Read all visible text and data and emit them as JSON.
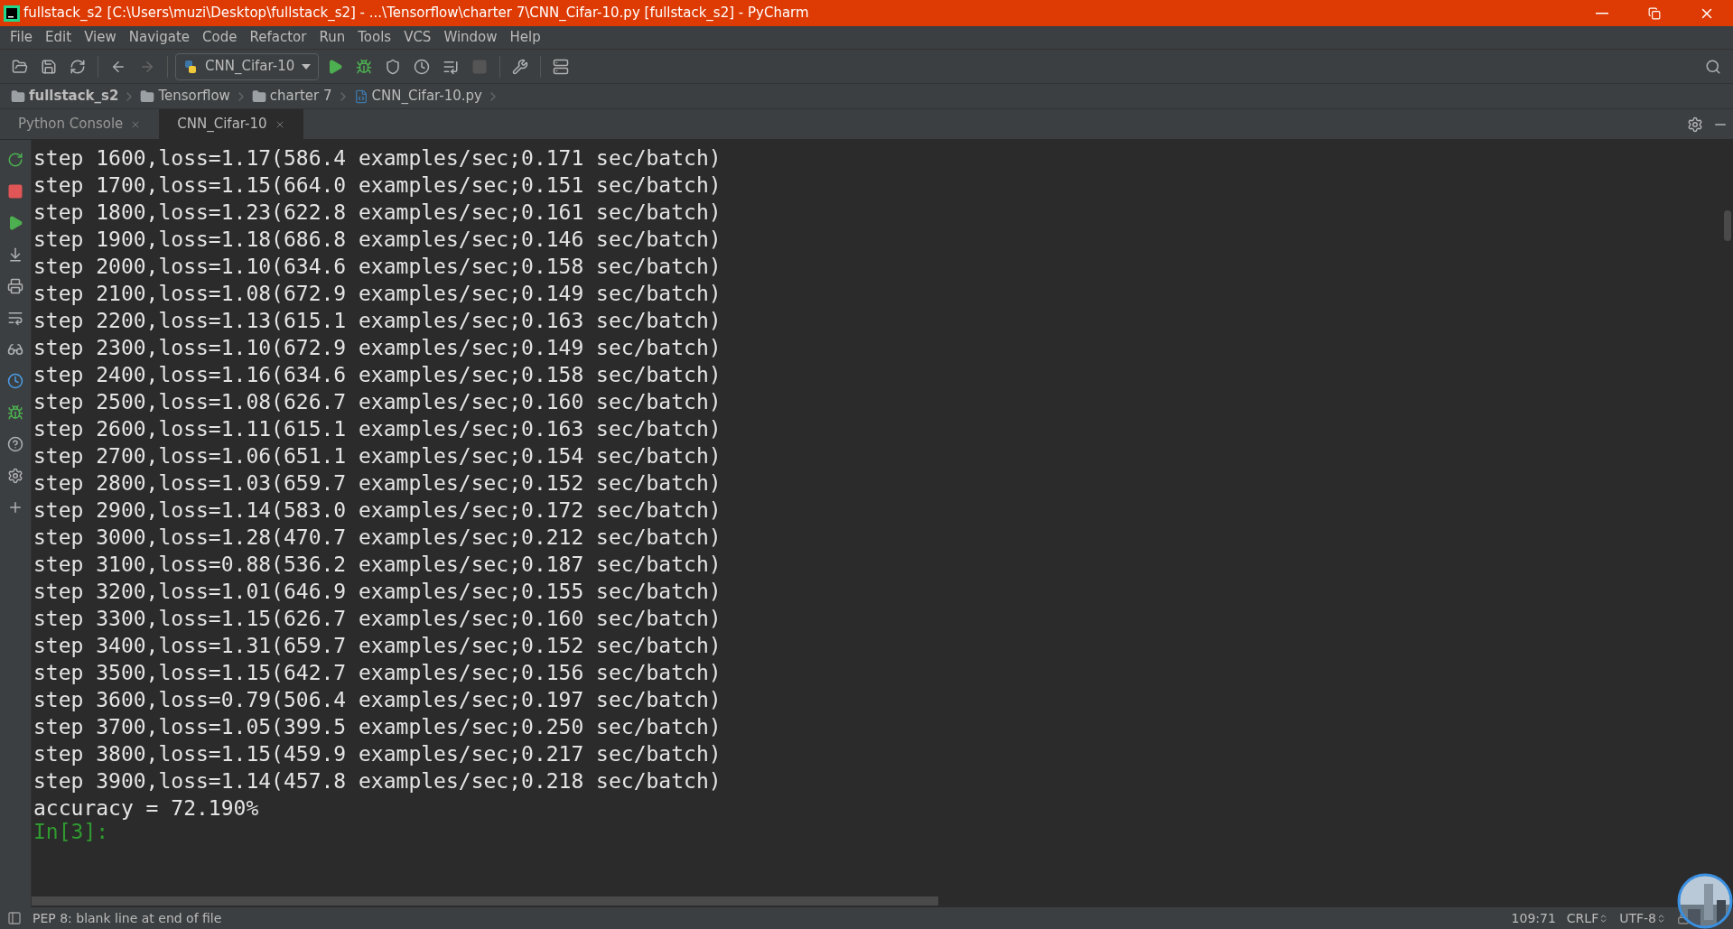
{
  "window": {
    "title": "fullstack_s2 [C:\\Users\\muzi\\Desktop\\fullstack_s2] - ...\\Tensorflow\\charter 7\\CNN_Cifar-10.py [fullstack_s2] - PyCharm"
  },
  "menu": [
    "File",
    "Edit",
    "View",
    "Navigate",
    "Code",
    "Refactor",
    "Run",
    "Tools",
    "VCS",
    "Window",
    "Help"
  ],
  "toolbar": {
    "run_config": "CNN_Cifar-10"
  },
  "breadcrumbs": [
    {
      "label": "fullstack_s2",
      "kind": "folder",
      "bold": true
    },
    {
      "label": "Tensorflow",
      "kind": "package",
      "bold": false
    },
    {
      "label": "charter 7",
      "kind": "folder",
      "bold": false
    },
    {
      "label": "CNN_Cifar-10.py",
      "kind": "file",
      "bold": false
    }
  ],
  "tabs": [
    {
      "label": "Python Console",
      "selected": false
    },
    {
      "label": "CNN_Cifar-10",
      "selected": true
    }
  ],
  "console": {
    "lines": [
      "step 1600,loss=1.17(586.4 examples/sec;0.171 sec/batch)",
      "step 1700,loss=1.15(664.0 examples/sec;0.151 sec/batch)",
      "step 1800,loss=1.23(622.8 examples/sec;0.161 sec/batch)",
      "step 1900,loss=1.18(686.8 examples/sec;0.146 sec/batch)",
      "step 2000,loss=1.10(634.6 examples/sec;0.158 sec/batch)",
      "step 2100,loss=1.08(672.9 examples/sec;0.149 sec/batch)",
      "step 2200,loss=1.13(615.1 examples/sec;0.163 sec/batch)",
      "step 2300,loss=1.10(672.9 examples/sec;0.149 sec/batch)",
      "step 2400,loss=1.16(634.6 examples/sec;0.158 sec/batch)",
      "step 2500,loss=1.08(626.7 examples/sec;0.160 sec/batch)",
      "step 2600,loss=1.11(615.1 examples/sec;0.163 sec/batch)",
      "step 2700,loss=1.06(651.1 examples/sec;0.154 sec/batch)",
      "step 2800,loss=1.03(659.7 examples/sec;0.152 sec/batch)",
      "step 2900,loss=1.14(583.0 examples/sec;0.172 sec/batch)",
      "step 3000,loss=1.28(470.7 examples/sec;0.212 sec/batch)",
      "step 3100,loss=0.88(536.2 examples/sec;0.187 sec/batch)",
      "step 3200,loss=1.01(646.9 examples/sec;0.155 sec/batch)",
      "step 3300,loss=1.15(626.7 examples/sec;0.160 sec/batch)",
      "step 3400,loss=1.31(659.7 examples/sec;0.152 sec/batch)",
      "step 3500,loss=1.15(642.7 examples/sec;0.156 sec/batch)",
      "step 3600,loss=0.79(506.4 examples/sec;0.197 sec/batch)",
      "step 3700,loss=1.05(399.5 examples/sec;0.250 sec/batch)",
      "step 3800,loss=1.15(459.9 examples/sec;0.217 sec/batch)",
      "step 3900,loss=1.14(457.8 examples/sec;0.218 sec/batch)",
      "accuracy = 72.190%"
    ],
    "prompt": "In[3]:"
  },
  "status_bar": {
    "message": "PEP 8: blank line at end of file",
    "position": "109:71",
    "line_separator": "CRLF",
    "encoding": "UTF-8"
  }
}
